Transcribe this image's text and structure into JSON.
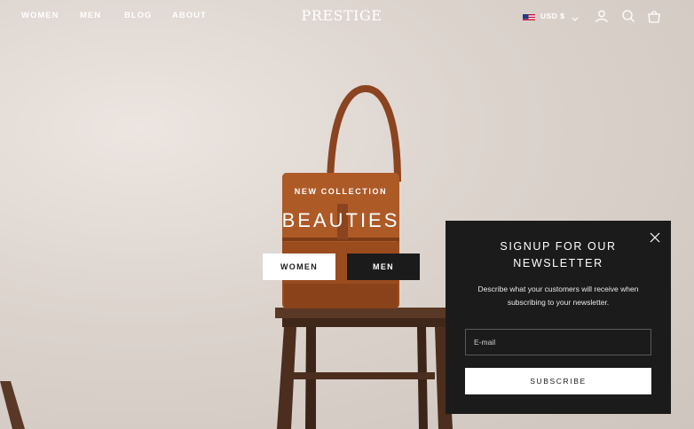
{
  "header": {
    "nav": [
      {
        "label": "WOMEN"
      },
      {
        "label": "MEN"
      },
      {
        "label": "BLOG"
      },
      {
        "label": "ABOUT"
      }
    ],
    "logo": "PRESTIGE",
    "currency": "USD $",
    "icons": [
      "us-flag-icon",
      "chevron-down-icon",
      "account-icon",
      "search-icon",
      "cart-icon"
    ]
  },
  "hero": {
    "eyebrow": "NEW COLLECTION",
    "headline": "BEAUTIES",
    "buttons": [
      {
        "label": "WOMEN"
      },
      {
        "label": "MEN"
      }
    ]
  },
  "newsletter": {
    "title_line1": "SIGNUP FOR OUR",
    "title_line2": "NEWSLETTER",
    "text_line1": "Describe what your customers will receive when",
    "text_line2": "subscribing to your newsletter.",
    "email_placeholder": "E-mail",
    "subscribe_label": "SUBSCRIBE"
  },
  "colors": {
    "popup_bg": "#1b1b1b",
    "hero_bg": "#d9d1cb",
    "bag": "#9a4c1f",
    "stool": "#4b2e1e"
  }
}
